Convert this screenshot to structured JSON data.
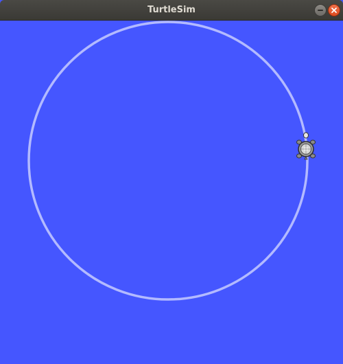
{
  "window": {
    "title": "TurtleSim"
  },
  "colors": {
    "background": "#4556ff",
    "pen_trail": "#b3baff",
    "titlebar": "#3f3e3a",
    "close_button": "#e95420"
  },
  "icons": {
    "minimize": "minimize-icon",
    "close": "close-icon",
    "turtle": "turtle-icon"
  }
}
